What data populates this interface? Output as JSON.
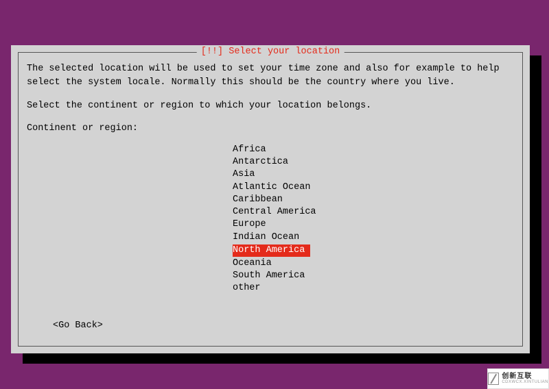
{
  "dialog": {
    "title": "[!!] Select your location",
    "description": "The selected location will be used to set your time zone and also for example to help select the system locale. Normally this should be the country where you live.",
    "prompt": "Select the continent or region to which your location belongs.",
    "field_label": "Continent or region:",
    "regions": [
      {
        "label": "Africa",
        "selected": false
      },
      {
        "label": "Antarctica",
        "selected": false
      },
      {
        "label": "Asia",
        "selected": false
      },
      {
        "label": "Atlantic Ocean",
        "selected": false
      },
      {
        "label": "Caribbean",
        "selected": false
      },
      {
        "label": "Central America",
        "selected": false
      },
      {
        "label": "Europe",
        "selected": false
      },
      {
        "label": "Indian Ocean",
        "selected": false
      },
      {
        "label": "North America",
        "selected": true
      },
      {
        "label": "Oceania",
        "selected": false
      },
      {
        "label": "South America",
        "selected": false
      },
      {
        "label": "other",
        "selected": false
      }
    ],
    "go_back": "<Go Back>"
  },
  "watermark": {
    "main": "创新互联",
    "sub": "CDXWCX.XINTULIAN"
  },
  "colors": {
    "background": "#79266d",
    "dialog_bg": "#d3d3d3",
    "accent": "#e42b1b"
  }
}
